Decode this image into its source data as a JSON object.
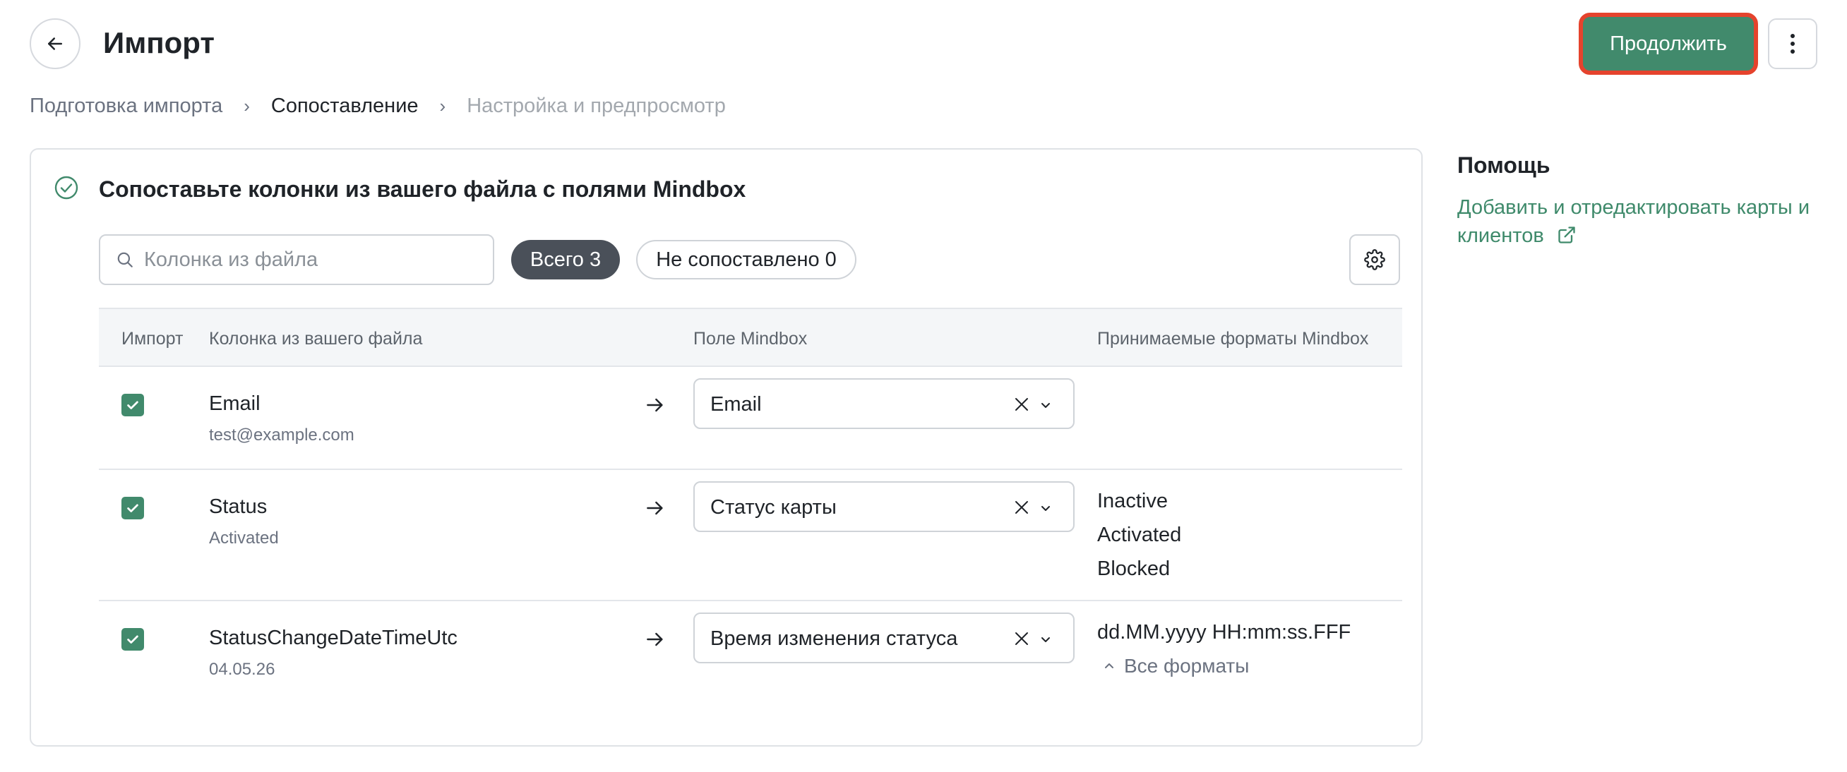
{
  "header": {
    "title": "Импорт",
    "continue_label": "Продолжить"
  },
  "breadcrumb": [
    {
      "label": "Подготовка импорта",
      "state": "done"
    },
    {
      "label": "Сопоставление",
      "state": "active"
    },
    {
      "label": "Настройка и предпросмотр",
      "state": "upcoming"
    }
  ],
  "mapping": {
    "title": "Сопоставьте колонки из вашего файла с полями Mindbox",
    "search_placeholder": "Колонка из файла",
    "filter_all": "Всего 3",
    "filter_unmatched": "Не сопоставлено 0",
    "columns": {
      "import": "Импорт",
      "file_column": "Колонка из вашего файла",
      "mindbox_field": "Поле Mindbox",
      "formats": "Принимаемые форматы Mindbox"
    },
    "rows": [
      {
        "checked": true,
        "name": "Email",
        "sample": "test@example.com",
        "field": "Email",
        "formats": []
      },
      {
        "checked": true,
        "name": "Status",
        "sample": "Activated",
        "field": "Статус карты",
        "formats": [
          "Inactive",
          "Activated",
          "Blocked"
        ]
      },
      {
        "checked": true,
        "name": "StatusChangeDateTimeUtc",
        "sample": "04.05.26",
        "field": "Время изменения статуса",
        "formats": [
          "dd.MM.yyyy HH:mm:ss.FFF"
        ],
        "all_formats_label": "Все форматы"
      }
    ]
  },
  "help": {
    "title": "Помощь",
    "link_text": "Добавить и отредактировать карты и клиентов"
  },
  "colors": {
    "accent": "#418a6c",
    "highlight_border": "#e5432d",
    "link": "#3f8a6b",
    "chip_dark": "#4a5059"
  }
}
